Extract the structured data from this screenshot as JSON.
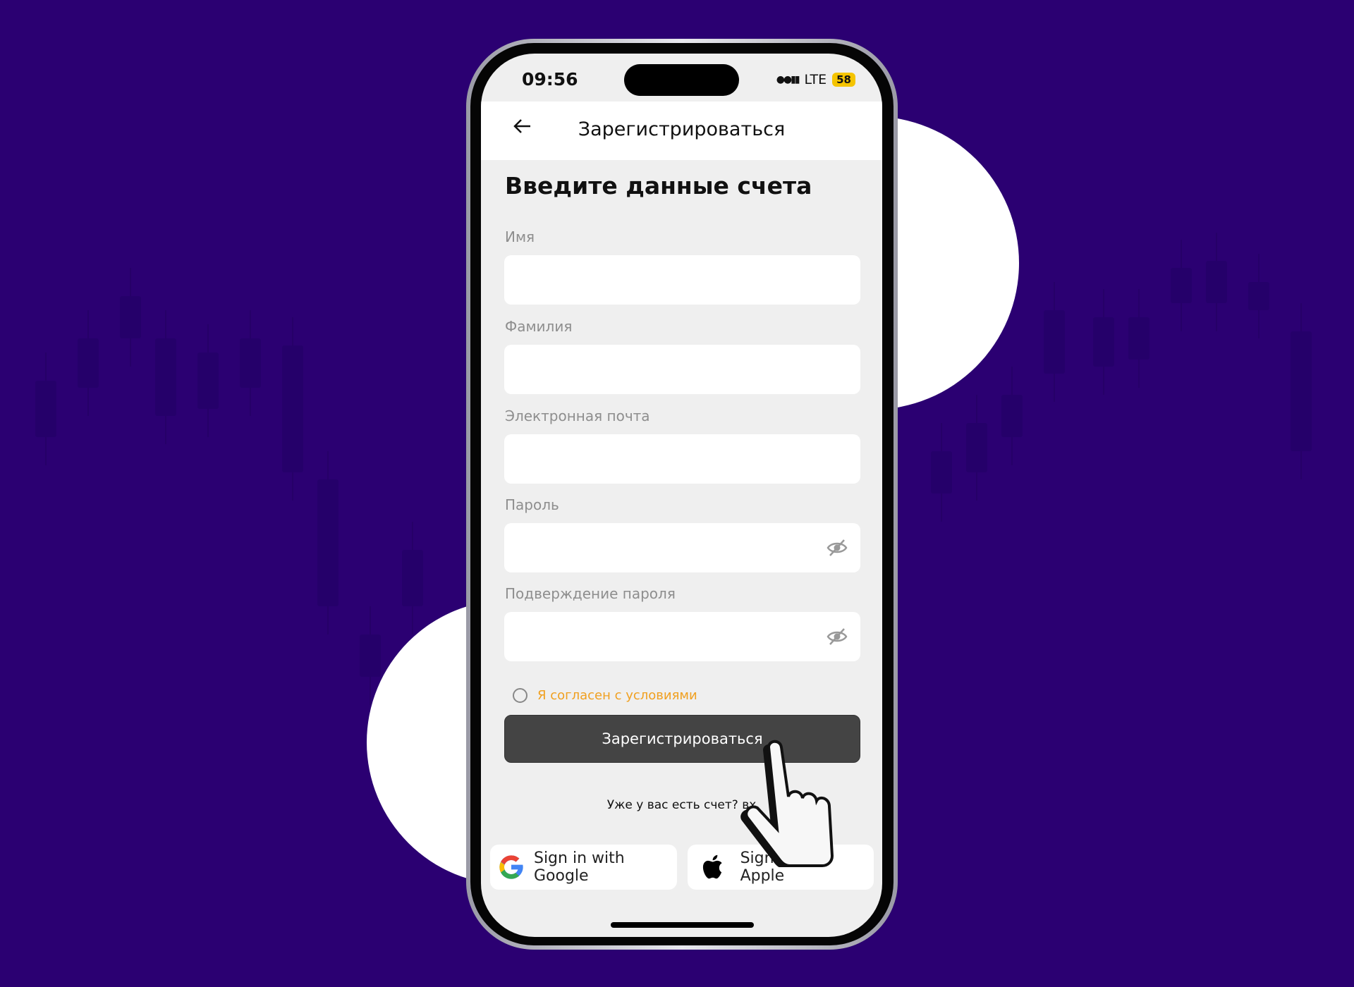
{
  "status_bar": {
    "time": "09:56",
    "network": "LTE",
    "battery": "58"
  },
  "header": {
    "title": "Зарегистрироваться",
    "back_icon": "arrow-left-icon"
  },
  "form": {
    "heading": "Введите данные счета",
    "fields": [
      {
        "label": "Имя",
        "value": ""
      },
      {
        "label": "Фамилия",
        "value": ""
      },
      {
        "label": "Электронная почта",
        "value": ""
      },
      {
        "label": "Пароль",
        "value": "",
        "icon": "eye-off-icon"
      },
      {
        "label": "Подверждение пароля",
        "value": "",
        "icon": "eye-off-icon"
      }
    ],
    "terms_label": "Я согласен с условиями",
    "submit_label": "Зарегистрироваться",
    "have_account": "Уже у вас есть счет? вх"
  },
  "social": {
    "google": "Sign in with Google",
    "apple": "Sign in with Apple"
  },
  "colors": {
    "background": "#2b0072",
    "accent": "#f0a020",
    "button": "#444444",
    "battery": "#f5c400"
  }
}
